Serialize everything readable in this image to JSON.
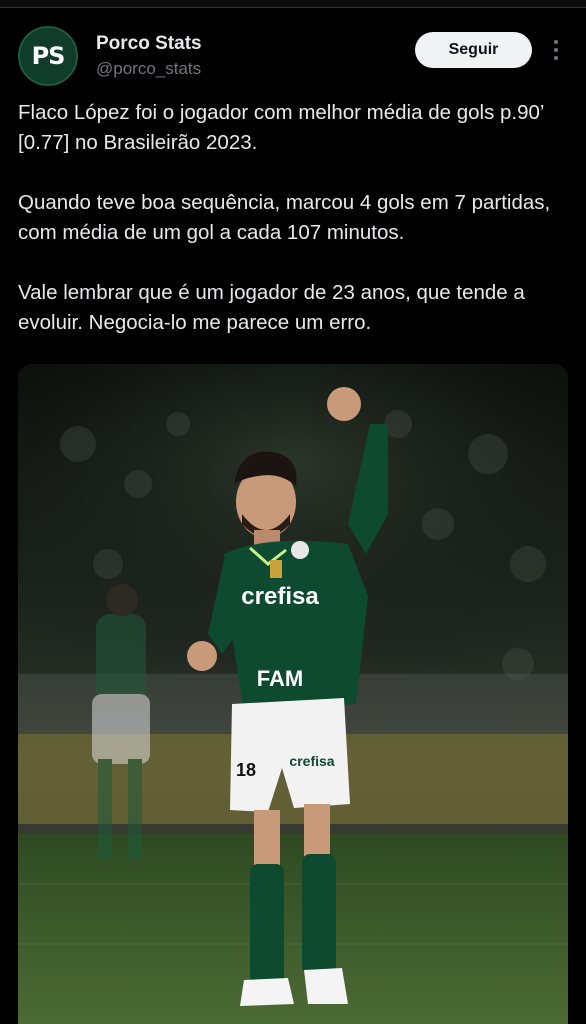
{
  "account": {
    "display_name": "Porco Stats",
    "handle": "@porco_stats",
    "avatar_initials": "PS"
  },
  "follow_label": "Seguir",
  "tweet": {
    "paragraphs": [
      "Flaco López foi o jogador com melhor média de gols p.90’ [0.77] no Brasileirão 2023.",
      "Quando teve boa sequência, marcou 4 gols em 7 partidas, com média de um gol a cada 107 minutos.",
      "Vale lembrar que é um jogador de 23 anos, que tende a evoluir. Negocia-lo me parece um erro."
    ]
  },
  "photo": {
    "shirt_sponsor": "crefisa",
    "sleeve_sponsor": "FAM",
    "shorts_sponsor": "crefisa",
    "shorts_number": "18",
    "colors": {
      "kit_green": "#0d4a30",
      "shorts": "#f2f2f2",
      "pitch": "#3e5a2a"
    }
  }
}
